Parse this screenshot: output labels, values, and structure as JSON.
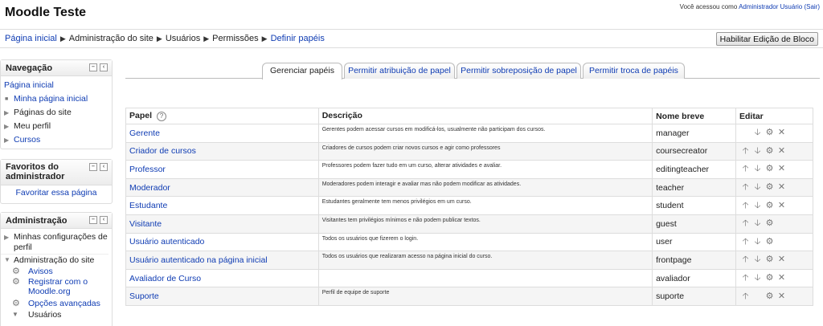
{
  "site": {
    "title": "Moodle Teste"
  },
  "login": {
    "prefix": "Você acessou como ",
    "user": "Administrador Usuário",
    "logout": "(Sair)"
  },
  "breadcrumb": [
    "Página inicial",
    "Administração do site",
    "Usuários",
    "Permissões",
    "Definir papéis"
  ],
  "edit_button": "Habilitar Edição de Bloco",
  "blocks": {
    "navigation": {
      "title": "Navegação",
      "home": "Página inicial",
      "items": [
        "Minha página inicial",
        "Páginas do site",
        "Meu perfil",
        "Cursos"
      ]
    },
    "favorites": {
      "title_line1": "Favoritos do",
      "title_line2": "administrador",
      "link": "Favoritar essa página"
    },
    "admin": {
      "title": "Administração",
      "items": [
        "Minhas configurações de",
        "perfil",
        "Administração do site",
        "Avisos",
        "Registrar com o",
        "Moodle.org",
        "Opções avançadas",
        "Usuários"
      ]
    }
  },
  "tabs": [
    "Gerenciar papéis",
    "Permitir atribuição de papel",
    "Permitir sobreposição de papel",
    "Permitir troca de papéis"
  ],
  "table": {
    "headers": {
      "role": "Papel",
      "description": "Descrição",
      "shortname": "Nome breve",
      "edit": "Editar"
    },
    "rows": [
      {
        "name": "Gerente",
        "desc": "Gerentes podem acessar cursos em modificá-los, usualmente não participam dos cursos.",
        "short": "manager"
      },
      {
        "name": "Criador de cursos",
        "desc": "Criadores de cursos podem criar novos cursos e agir como professores",
        "short": "coursecreator"
      },
      {
        "name": "Professor",
        "desc": "Professores podem fazer tudo em um curso, alterar atividades e avaliar.",
        "short": "editingteacher"
      },
      {
        "name": "Moderador",
        "desc": "Moderadores podem interagir e avaliar mas não podem modificar as atividades.",
        "short": "teacher"
      },
      {
        "name": "Estudante",
        "desc": "Estudantes geralmente tem menos privilégios em um curso.",
        "short": "student"
      },
      {
        "name": "Visitante",
        "desc": "Visitantes tem privilégios mínimos e não podem publicar textos.",
        "short": "guest"
      },
      {
        "name": "Usuário autenticado",
        "desc": "Todos os usuários que fizerem o login.",
        "short": "user"
      },
      {
        "name": "Usuário autenticado na página inicial",
        "desc": "Todos os usuários que realizaram acesso na página inicial do curso.",
        "short": "frontpage"
      },
      {
        "name": "Avaliador de Curso",
        "desc": "",
        "short": "avaliador"
      },
      {
        "name": "Suporte",
        "desc": "Perfil de equipe de suporte",
        "short": "suporte"
      }
    ]
  },
  "icons": {
    "up": "arrow-up-icon",
    "down": "arrow-down-icon",
    "settings": "gear-icon",
    "delete": "delete-icon",
    "help": "help-icon"
  },
  "colors": {
    "link": "#0f3cb3",
    "border": "#dddddd"
  }
}
